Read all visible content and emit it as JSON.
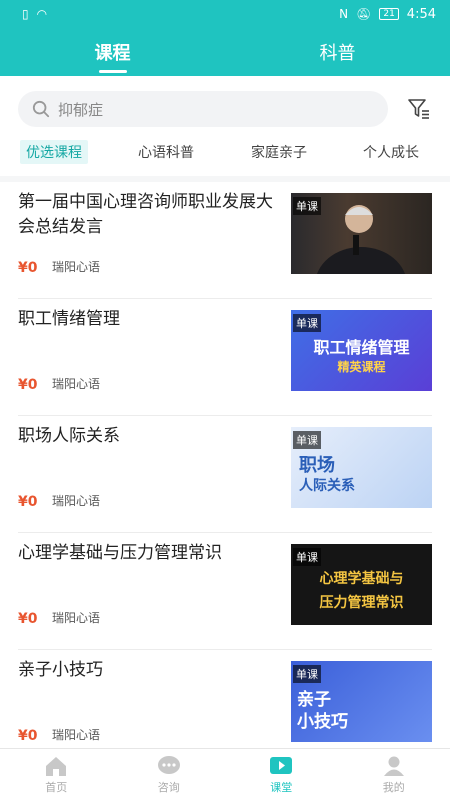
{
  "status": {
    "time": "4:54",
    "battery": "21"
  },
  "header": {
    "tabs": [
      {
        "label": "课程"
      },
      {
        "label": "科普"
      }
    ]
  },
  "search": {
    "text": "抑郁症"
  },
  "categories": [
    {
      "label": "优选课程"
    },
    {
      "label": "心语科普"
    },
    {
      "label": "家庭亲子"
    },
    {
      "label": "个人成长"
    }
  ],
  "courses": [
    {
      "title": "第一届中国心理咨询师职业发展大会总结发言",
      "price": "¥0",
      "source": "瑞阳心语",
      "badge": "单课"
    },
    {
      "title": "职工情绪管理",
      "price": "¥0",
      "source": "瑞阳心语",
      "badge": "单课",
      "thumb_title": "职工情绪管理",
      "thumb_sub": "精英课程"
    },
    {
      "title": "职场人际关系",
      "price": "¥0",
      "source": "瑞阳心语",
      "badge": "单课",
      "thumb_title": "职场",
      "thumb_sub": "人际关系"
    },
    {
      "title": "心理学基础与压力管理常识",
      "price": "¥0",
      "source": "瑞阳心语",
      "badge": "单课",
      "thumb_title": "心理学基础与",
      "thumb_sub": "压力管理常识"
    },
    {
      "title": "亲子小技巧",
      "price": "¥0",
      "source": "瑞阳心语",
      "badge": "单课",
      "thumb_title": "亲子",
      "thumb_sub": "小技巧"
    }
  ],
  "bottom_nav": [
    {
      "label": "首页"
    },
    {
      "label": "咨询"
    },
    {
      "label": "课堂"
    },
    {
      "label": "我的"
    }
  ],
  "colors": {
    "accent": "#1fc4c0",
    "price": "#e8552f"
  }
}
